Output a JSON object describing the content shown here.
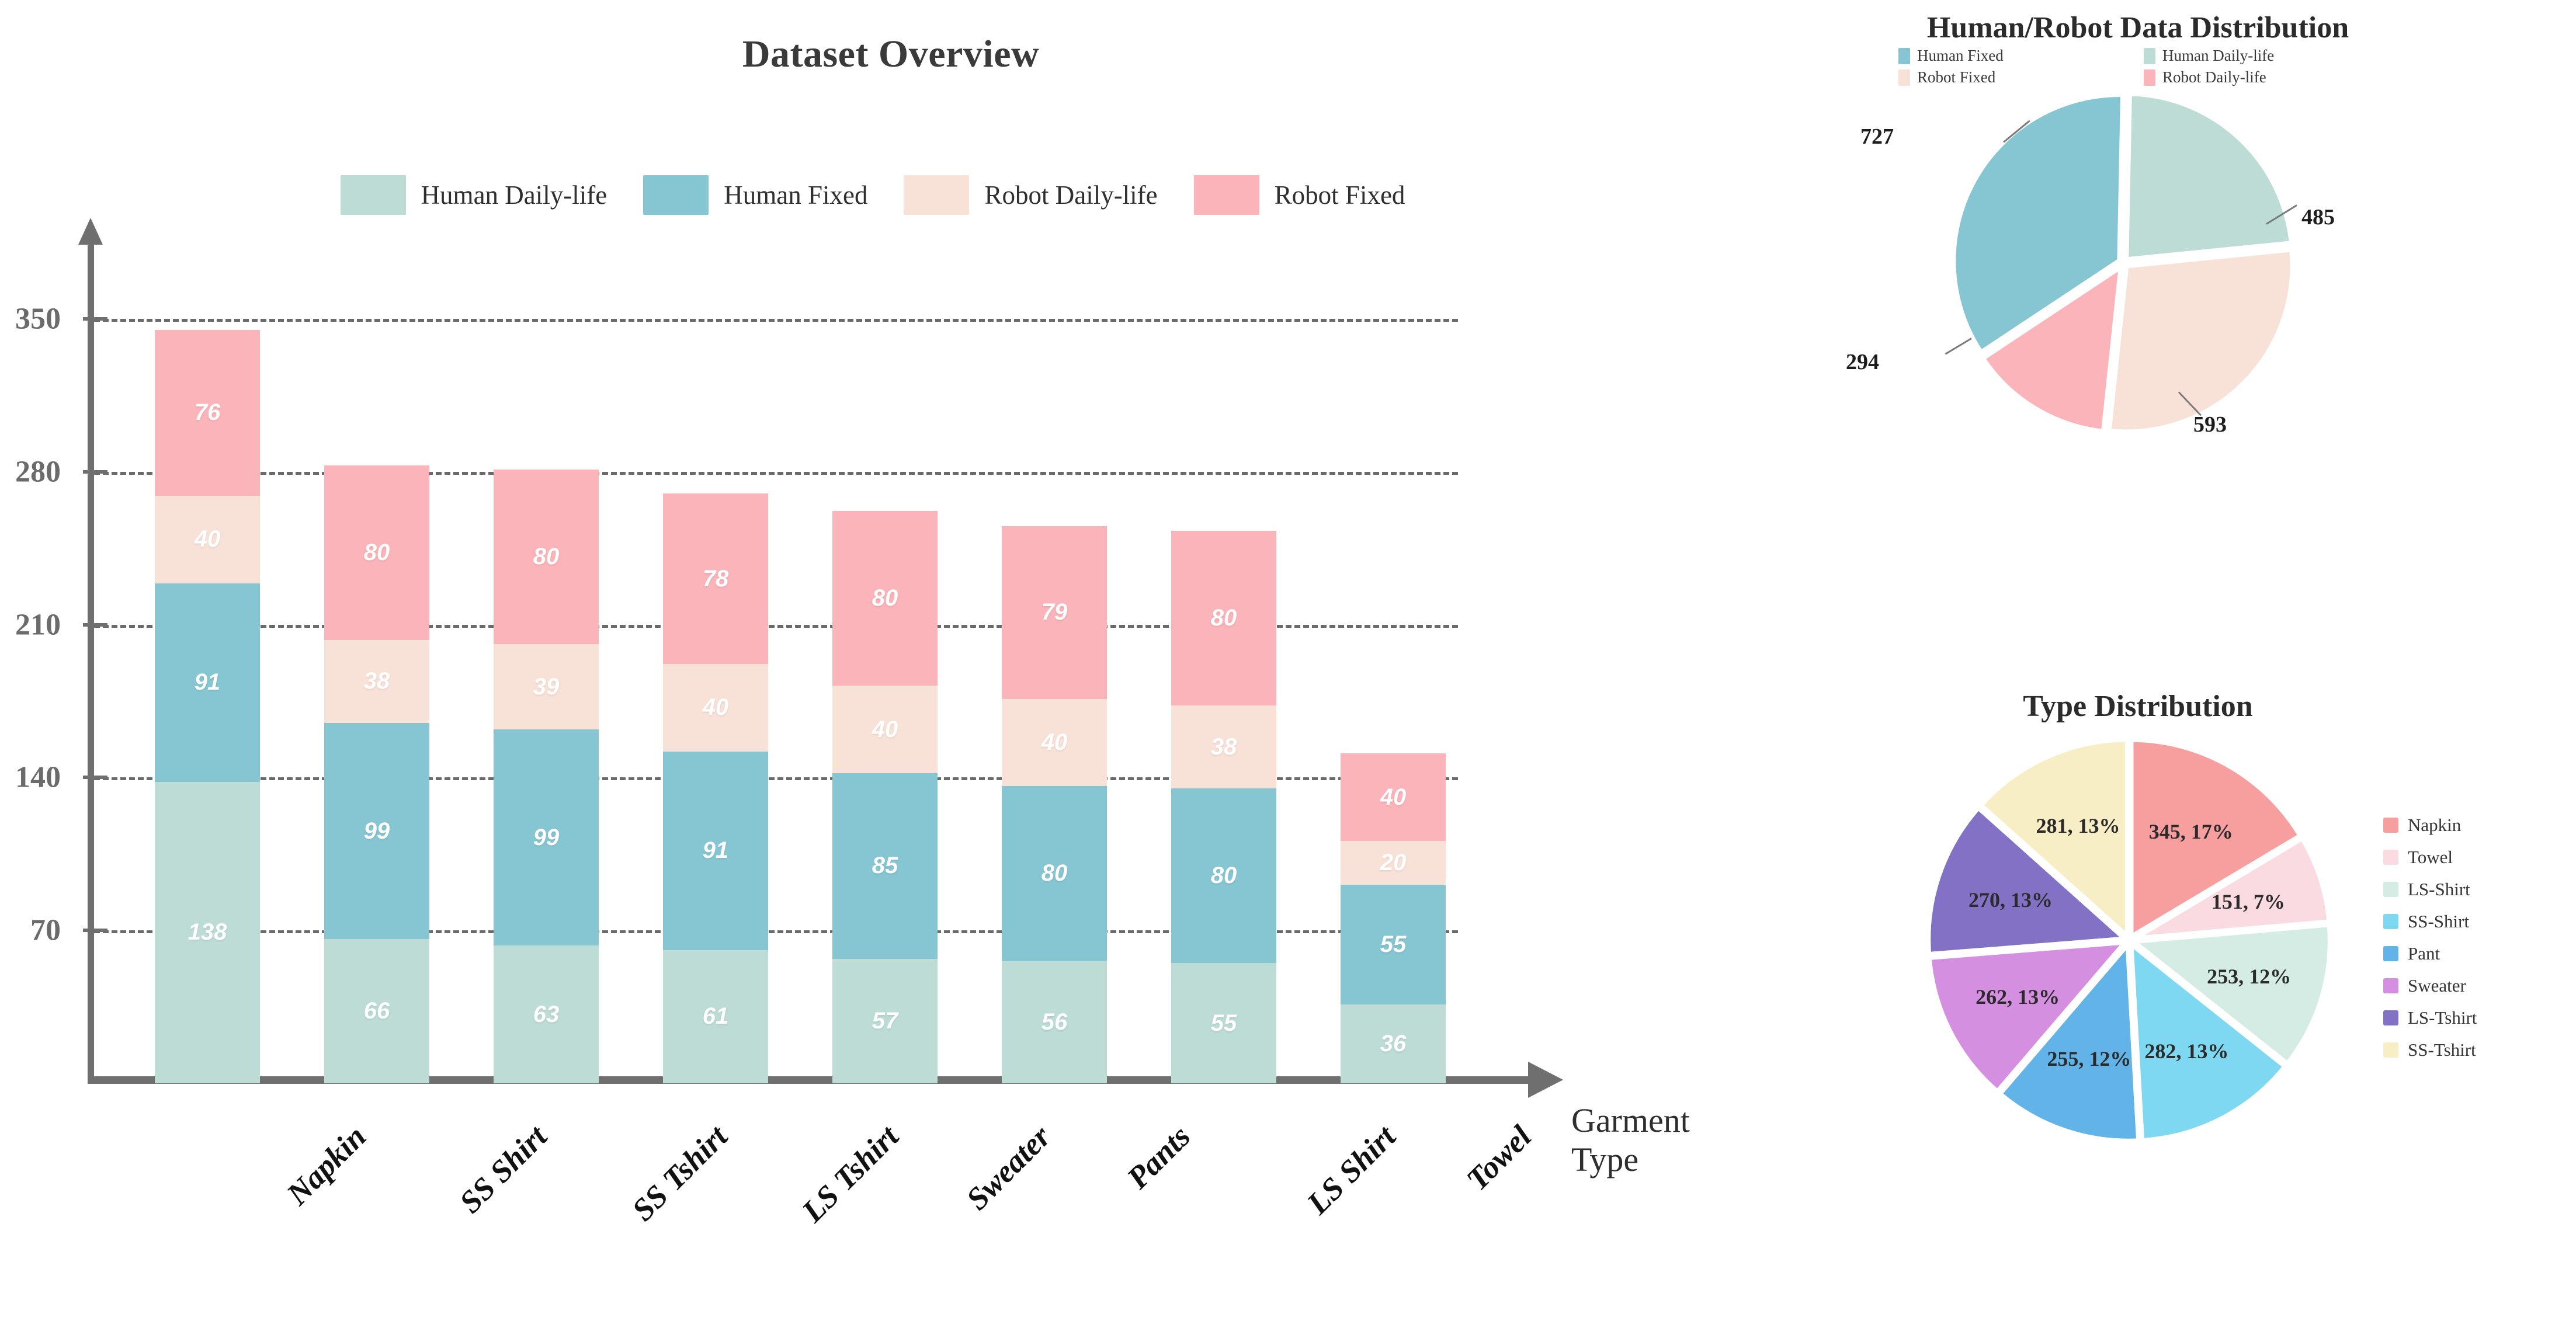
{
  "bar_chart": {
    "title": "Dataset Overview",
    "xlabel": "Garment Type",
    "legend": [
      {
        "label": "Human Daily-life",
        "color": "#bcdcd5"
      },
      {
        "label": "Human Fixed",
        "color": "#86c6d2"
      },
      {
        "label": "Robot Daily-life",
        "color": "#f8e2d8"
      },
      {
        "label": "Robot Fixed",
        "color": "#fbb4b9"
      }
    ],
    "yticks": [
      "70",
      "140",
      "210",
      "280",
      "350"
    ]
  },
  "pie_top": {
    "title": "Human/Robot Data Distribution",
    "legend": [
      {
        "label": "Human Fixed",
        "color": "#86c6d2"
      },
      {
        "label": "Human Daily-life",
        "color": "#bcdcd5"
      },
      {
        "label": "Robot Fixed",
        "color": "#f8e2d8"
      },
      {
        "label": "Robot Daily-life",
        "color": "#fbb4b9"
      }
    ],
    "labels": [
      "727",
      "485",
      "593",
      "294"
    ]
  },
  "pie_bottom": {
    "title": "Type Distribution",
    "legend": [
      {
        "label": "Napkin",
        "color": "#f79f9f"
      },
      {
        "label": "Towel",
        "color": "#fadbe2"
      },
      {
        "label": "LS-Shirt",
        "color": "#d4ece4"
      },
      {
        "label": "SS-Shirt",
        "color": "#7fd8f2"
      },
      {
        "label": "Pant",
        "color": "#62b4e8"
      },
      {
        "label": "Sweater",
        "color": "#d58fe0"
      },
      {
        "label": "LS-Tshirt",
        "color": "#8271c4"
      },
      {
        "label": "SS-Tshirt",
        "color": "#f8eec6"
      }
    ],
    "labels": [
      "345, 17%",
      "151, 7%",
      "253, 12%",
      "282, 13%",
      "255, 12%",
      "262, 13%",
      "270, 13%",
      "281, 13%"
    ]
  },
  "chart_data": [
    {
      "type": "bar",
      "subtype": "stacked-vertical",
      "title": "Dataset Overview",
      "xlabel": "Garment Type",
      "ylabel": "",
      "ylim": [
        0,
        385
      ],
      "yticks": [
        70,
        140,
        210,
        280,
        350
      ],
      "grid": true,
      "legend_position": "top",
      "categories": [
        "Napkin",
        "SS Shirt",
        "SS Tshirt",
        "LS Tshirt",
        "Sweater",
        "Pants",
        "LS Shirt",
        "Towel"
      ],
      "series": [
        {
          "name": "Human Daily-life",
          "color": "#bcdcd5",
          "values": [
            138,
            66,
            63,
            61,
            57,
            56,
            55,
            36
          ]
        },
        {
          "name": "Human Fixed",
          "color": "#86c6d2",
          "values": [
            91,
            99,
            99,
            91,
            85,
            80,
            80,
            55
          ]
        },
        {
          "name": "Robot Daily-life",
          "color": "#f8e2d8",
          "values": [
            40,
            38,
            39,
            40,
            40,
            40,
            38,
            20
          ]
        },
        {
          "name": "Robot Fixed",
          "color": "#fbb4b9",
          "values": [
            76,
            80,
            80,
            78,
            80,
            79,
            80,
            40
          ]
        }
      ],
      "totals": [
        345,
        283,
        281,
        270,
        262,
        255,
        253,
        151
      ]
    },
    {
      "type": "pie",
      "title": "Human/Robot Data Distribution",
      "legend_position": "top",
      "labels": [
        "Human Fixed",
        "Human Daily-life",
        "Robot Fixed",
        "Robot Daily-life"
      ],
      "values": [
        727,
        485,
        593,
        294
      ],
      "colors": [
        "#86c6d2",
        "#bcdcd5",
        "#f8e2d8",
        "#fbb4b9"
      ],
      "annotations": [
        "727",
        "485",
        "593",
        "294"
      ]
    },
    {
      "type": "pie",
      "title": "Type Distribution",
      "legend_position": "right",
      "labels": [
        "Napkin",
        "Towel",
        "LS-Shirt",
        "SS-Shirt",
        "Pant",
        "Sweater",
        "LS-Tshirt",
        "SS-Tshirt"
      ],
      "values": [
        345,
        151,
        253,
        282,
        255,
        262,
        270,
        281
      ],
      "percents": [
        17,
        7,
        12,
        13,
        12,
        13,
        13,
        13
      ],
      "colors": [
        "#f79f9f",
        "#fadbe2",
        "#d4ece4",
        "#7fd8f2",
        "#62b4e8",
        "#d58fe0",
        "#8271c4",
        "#f8eec6"
      ],
      "annotations": [
        "345, 17%",
        "151, 7%",
        "253, 12%",
        "282, 13%",
        "255, 12%",
        "262, 13%",
        "270, 13%",
        "281, 13%"
      ]
    }
  ]
}
